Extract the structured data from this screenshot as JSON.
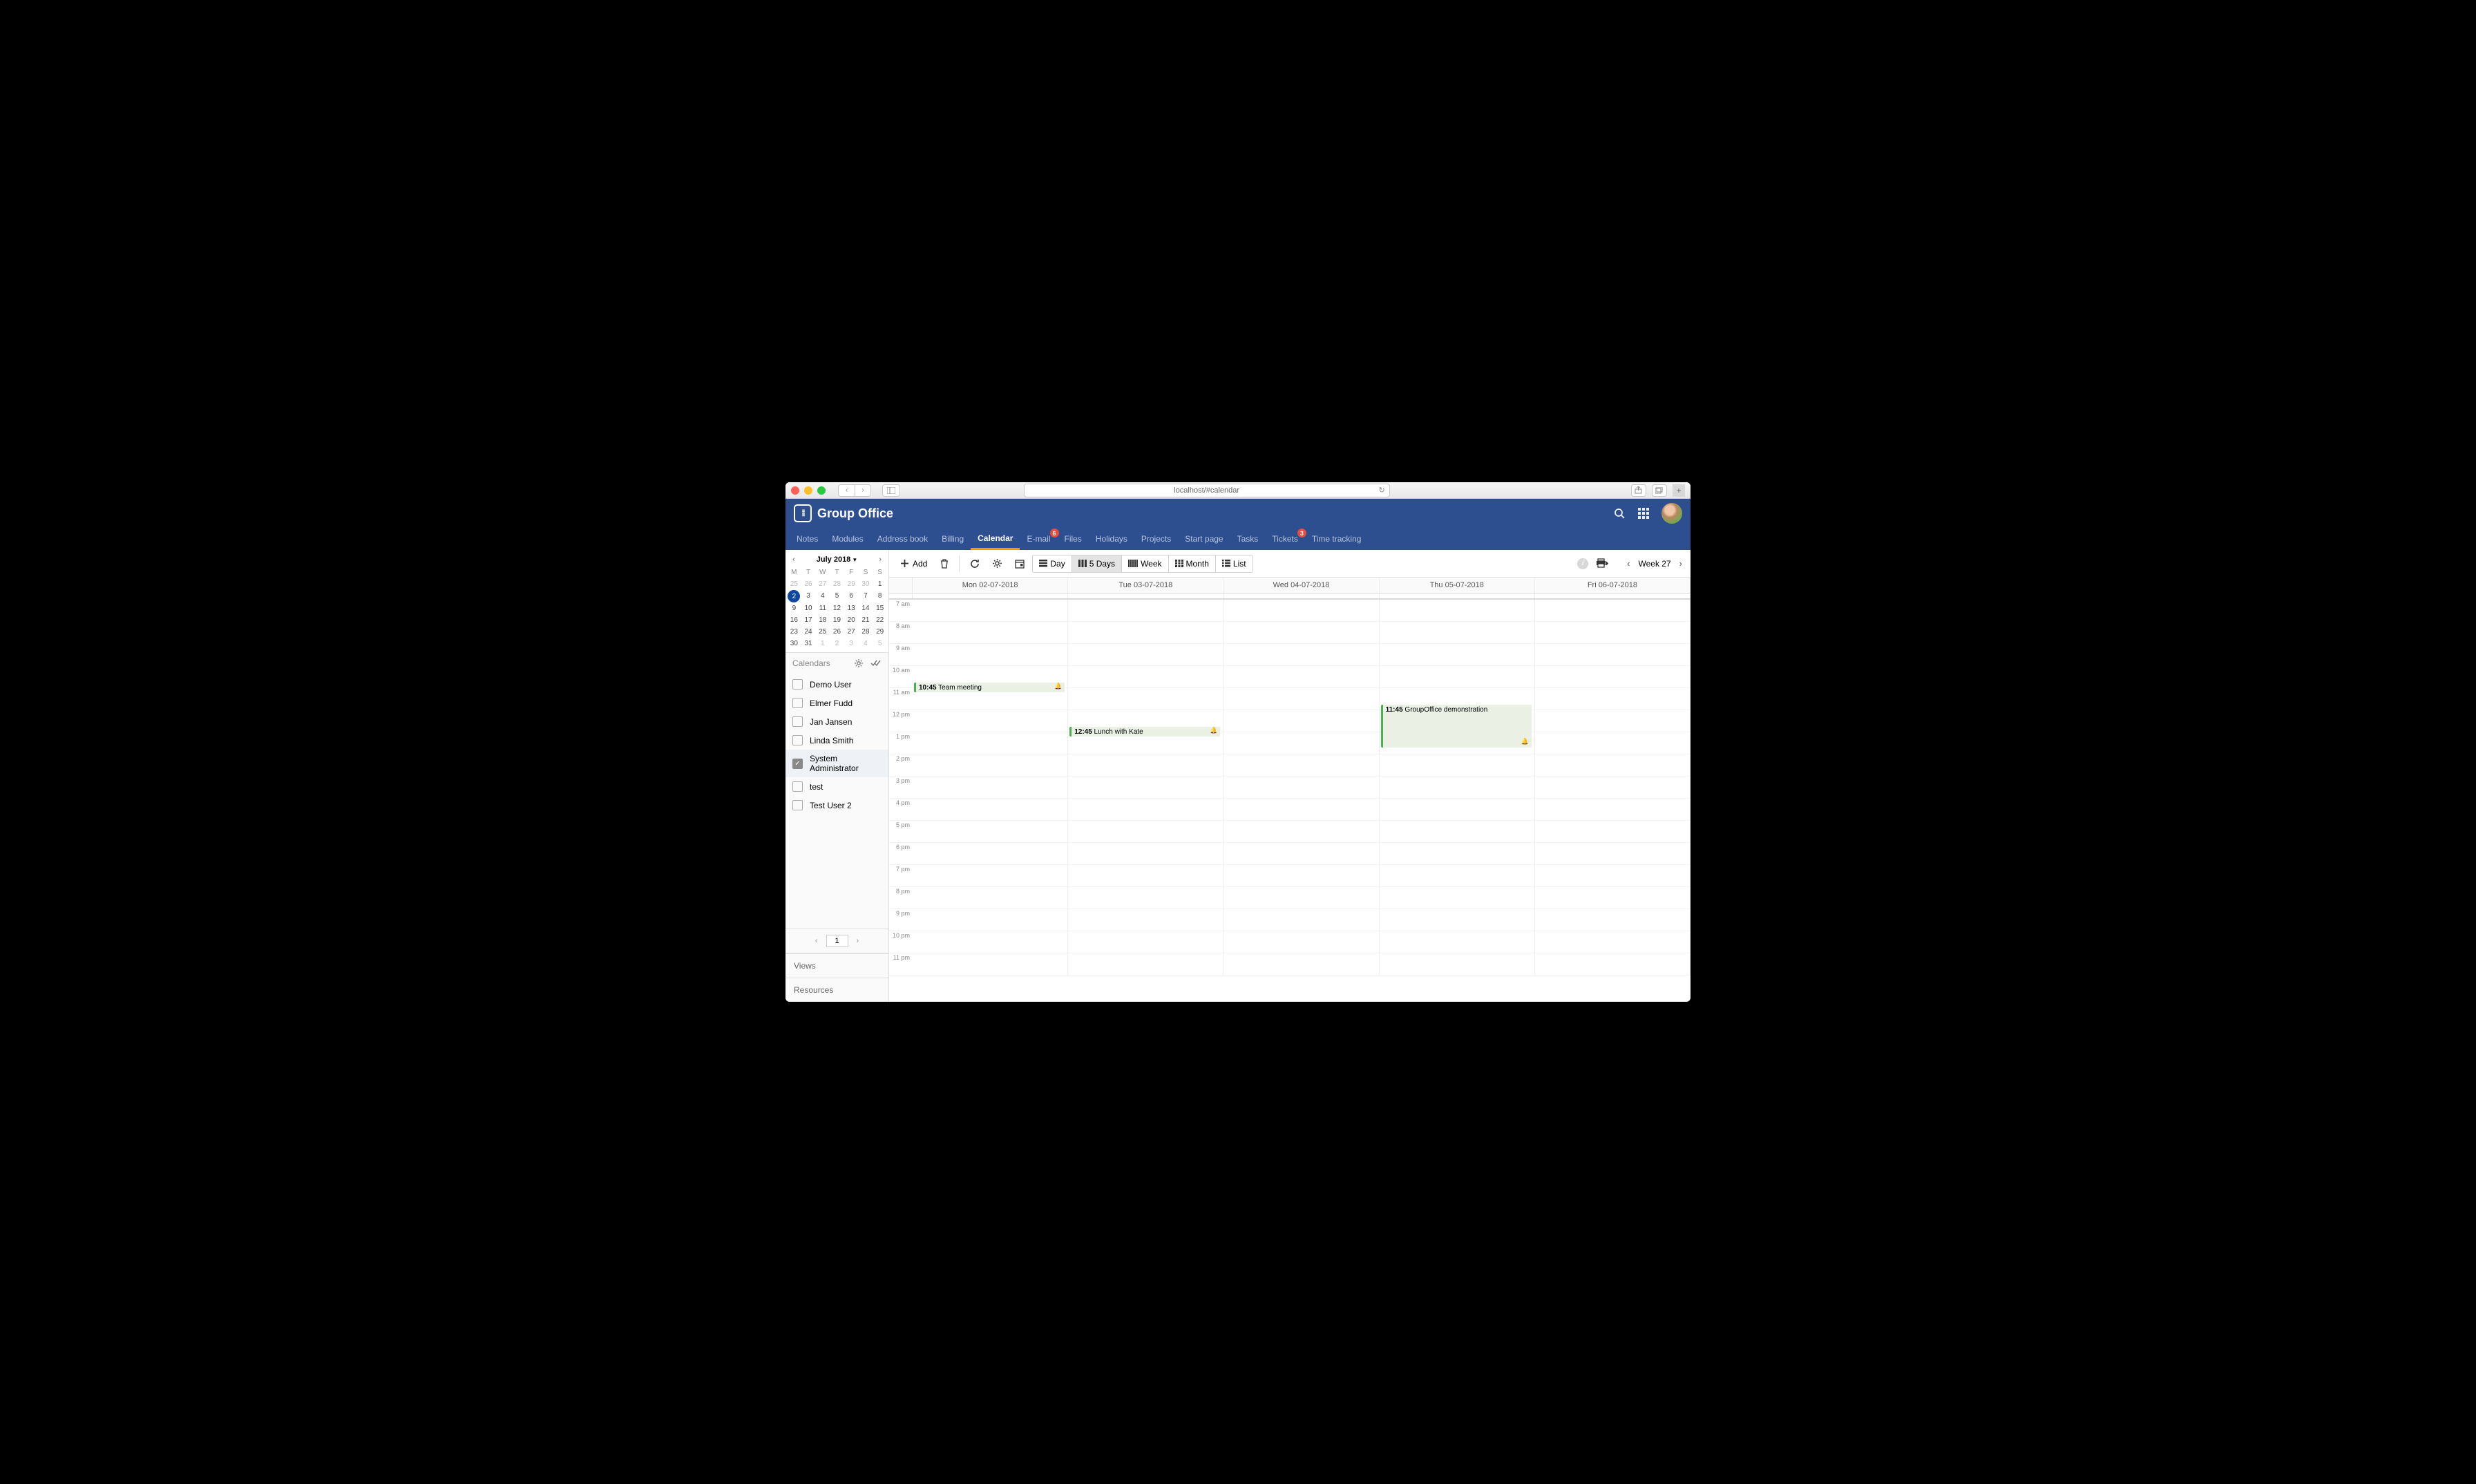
{
  "browser": {
    "url_display": "localhost/#calendar"
  },
  "app": {
    "name": "Group Office"
  },
  "tabs": [
    {
      "label": "Notes",
      "active": false
    },
    {
      "label": "Modules",
      "active": false
    },
    {
      "label": "Address book",
      "active": false
    },
    {
      "label": "Billing",
      "active": false
    },
    {
      "label": "Calendar",
      "active": true
    },
    {
      "label": "E-mail",
      "active": false,
      "badge": "6"
    },
    {
      "label": "Files",
      "active": false
    },
    {
      "label": "Holidays",
      "active": false
    },
    {
      "label": "Projects",
      "active": false
    },
    {
      "label": "Start page",
      "active": false
    },
    {
      "label": "Tasks",
      "active": false
    },
    {
      "label": "Tickets",
      "active": false,
      "badge": "3"
    },
    {
      "label": "Time tracking",
      "active": false
    }
  ],
  "mini_cal": {
    "title": "July 2018",
    "dow": [
      "M",
      "T",
      "W",
      "T",
      "F",
      "S",
      "S"
    ],
    "weeks": [
      [
        {
          "d": "25",
          "o": true
        },
        {
          "d": "26",
          "o": true
        },
        {
          "d": "27",
          "o": true
        },
        {
          "d": "28",
          "o": true
        },
        {
          "d": "29",
          "o": true
        },
        {
          "d": "30",
          "o": true
        },
        {
          "d": "1"
        }
      ],
      [
        {
          "d": "2",
          "today": true
        },
        {
          "d": "3"
        },
        {
          "d": "4"
        },
        {
          "d": "5"
        },
        {
          "d": "6"
        },
        {
          "d": "7"
        },
        {
          "d": "8"
        }
      ],
      [
        {
          "d": "9"
        },
        {
          "d": "10"
        },
        {
          "d": "11"
        },
        {
          "d": "12"
        },
        {
          "d": "13"
        },
        {
          "d": "14"
        },
        {
          "d": "15"
        }
      ],
      [
        {
          "d": "16"
        },
        {
          "d": "17"
        },
        {
          "d": "18"
        },
        {
          "d": "19"
        },
        {
          "d": "20"
        },
        {
          "d": "21"
        },
        {
          "d": "22"
        }
      ],
      [
        {
          "d": "23"
        },
        {
          "d": "24"
        },
        {
          "d": "25"
        },
        {
          "d": "26"
        },
        {
          "d": "27"
        },
        {
          "d": "28"
        },
        {
          "d": "29"
        }
      ],
      [
        {
          "d": "30"
        },
        {
          "d": "31"
        },
        {
          "d": "1",
          "o": true
        },
        {
          "d": "2",
          "o": true
        },
        {
          "d": "3",
          "o": true
        },
        {
          "d": "4",
          "o": true
        },
        {
          "d": "5",
          "o": true
        }
      ]
    ]
  },
  "sidebar": {
    "calendars_label": "Calendars",
    "calendars": [
      {
        "name": "Demo User",
        "checked": false
      },
      {
        "name": "Elmer Fudd",
        "checked": false
      },
      {
        "name": "Jan Jansen",
        "checked": false
      },
      {
        "name": "Linda Smith",
        "checked": false
      },
      {
        "name": "System Administrator",
        "checked": true
      },
      {
        "name": "test",
        "checked": false
      },
      {
        "name": "Test User 2",
        "checked": false
      }
    ],
    "page": "1",
    "views_label": "Views",
    "resources_label": "Resources"
  },
  "toolbar": {
    "add": "Add",
    "views": [
      {
        "label": "Day"
      },
      {
        "label": "5 Days",
        "active": true
      },
      {
        "label": "Week"
      },
      {
        "label": "Month"
      },
      {
        "label": "List"
      }
    ],
    "week_label": "Week 27"
  },
  "day_headers": [
    "Mon 02-07-2018",
    "Tue 03-07-2018",
    "Wed 04-07-2018",
    "Thu 05-07-2018",
    "Fri 06-07-2018"
  ],
  "time_labels": [
    "7 am",
    "8 am",
    "9 am",
    "10 am",
    "11 am",
    "12 pm",
    "1 pm",
    "2 pm",
    "3 pm",
    "4 pm",
    "5 pm",
    "6 pm",
    "7 pm",
    "8 pm",
    "9 pm",
    "10 pm",
    "11 pm"
  ],
  "events": [
    {
      "day": 0,
      "top_hr": 3.75,
      "dur_hr": 0.5,
      "time": "10:45",
      "title": "Team meeting"
    },
    {
      "day": 1,
      "top_hr": 5.75,
      "dur_hr": 0.5,
      "time": "12:45",
      "title": "Lunch with Kate"
    },
    {
      "day": 3,
      "top_hr": 4.75,
      "dur_hr": 2.0,
      "time": "11:45",
      "title": "GroupOffice demonstration"
    }
  ]
}
